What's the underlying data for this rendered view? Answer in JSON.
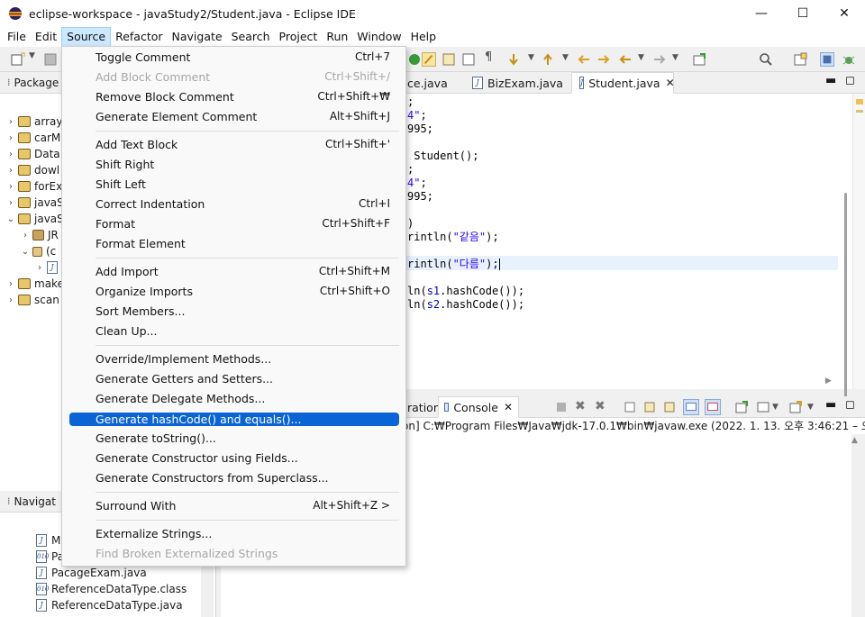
{
  "window": {
    "title": "eclipse-workspace - javaStudy2/Student.java - Eclipse IDE",
    "minimize": "—",
    "maximize": "☐",
    "close": "✕"
  },
  "menubar": [
    "File",
    "Edit",
    "Source",
    "Refactor",
    "Navigate",
    "Search",
    "Project",
    "Run",
    "Window",
    "Help"
  ],
  "left_panel": {
    "header_top": "Package",
    "tree": [
      "array",
      "carM",
      "Data",
      "dowl",
      "forEx",
      "javaS",
      "javaS",
      "JR",
      "(c",
      "",
      "make",
      "scan"
    ],
    "header_bottom": "Navigat",
    "files": [
      "M",
      "Pa",
      "PacageExam.java",
      "ReferenceDataType.class",
      "ReferenceDataType.java"
    ]
  },
  "editor_tabs": {
    "tab1": "ce.java",
    "tab2": "BizExam.java",
    "tab3": "Student.java",
    "tab3_close": "✕"
  },
  "code": {
    "l1": ";",
    "l2a": "4\"",
    "l2b": ";",
    "l3": "995;",
    "l4": " Student();",
    "l5": ";",
    "l6a": "4\"",
    "l6b": ";",
    "l7": "995;",
    "l8": ")",
    "l9a": "rintln(",
    "l9s": "\"같음\"",
    "l9b": ");",
    "l10a": "rintln(",
    "l10s": "\"다름\"",
    "l10b": ");",
    "l11a": "ln(",
    "l11f": "s1",
    "l11b": ".hashCode());",
    "l12a": "ln(",
    "l12f": "s2",
    "l12b": ".hashCode());"
  },
  "console": {
    "tab1": "ration",
    "tab2": "Console",
    "tab2_close": "✕",
    "header": "on] C:₩Program Files₩Java₩jdk-17.0.1₩bin₩javaw.exe  (2022. 1. 13. 오후 3:46:21 – 오후 3:46"
  },
  "source_menu": {
    "items": [
      {
        "label": "Toggle Comment",
        "accel": "Ctrl+7"
      },
      {
        "label": "Add Block Comment",
        "accel": "Ctrl+Shift+/"
      },
      {
        "label": "Remove Block Comment",
        "accel": "Ctrl+Shift+₩"
      },
      {
        "label": "Generate Element Comment",
        "accel": "Alt+Shift+J"
      },
      {
        "label": "Add Text Block",
        "accel": "Ctrl+Shift+'"
      },
      {
        "label": "Shift Right",
        "accel": ""
      },
      {
        "label": "Shift Left",
        "accel": ""
      },
      {
        "label": "Correct Indentation",
        "accel": "Ctrl+I"
      },
      {
        "label": "Format",
        "accel": "Ctrl+Shift+F"
      },
      {
        "label": "Format Element",
        "accel": ""
      },
      {
        "label": "Add Import",
        "accel": "Ctrl+Shift+M"
      },
      {
        "label": "Organize Imports",
        "accel": "Ctrl+Shift+O"
      },
      {
        "label": "Sort Members...",
        "accel": ""
      },
      {
        "label": "Clean Up...",
        "accel": ""
      },
      {
        "label": "Override/Implement Methods...",
        "accel": ""
      },
      {
        "label": "Generate Getters and Setters...",
        "accel": ""
      },
      {
        "label": "Generate Delegate Methods...",
        "accel": ""
      },
      {
        "label": "Generate hashCode() and equals()...",
        "accel": ""
      },
      {
        "label": "Generate toString()...",
        "accel": ""
      },
      {
        "label": "Generate Constructor using Fields...",
        "accel": ""
      },
      {
        "label": "Generate Constructors from Superclass...",
        "accel": ""
      },
      {
        "label": "Surround With",
        "accel": "Alt+Shift+Z >"
      },
      {
        "label": "Externalize Strings...",
        "accel": ""
      },
      {
        "label": "Find Broken Externalized Strings",
        "accel": ""
      }
    ]
  },
  "colors": {
    "selection": "#0a64d6",
    "menu_active": "#cce8ff",
    "string": "#2a00ff",
    "field": "#0000c0"
  }
}
